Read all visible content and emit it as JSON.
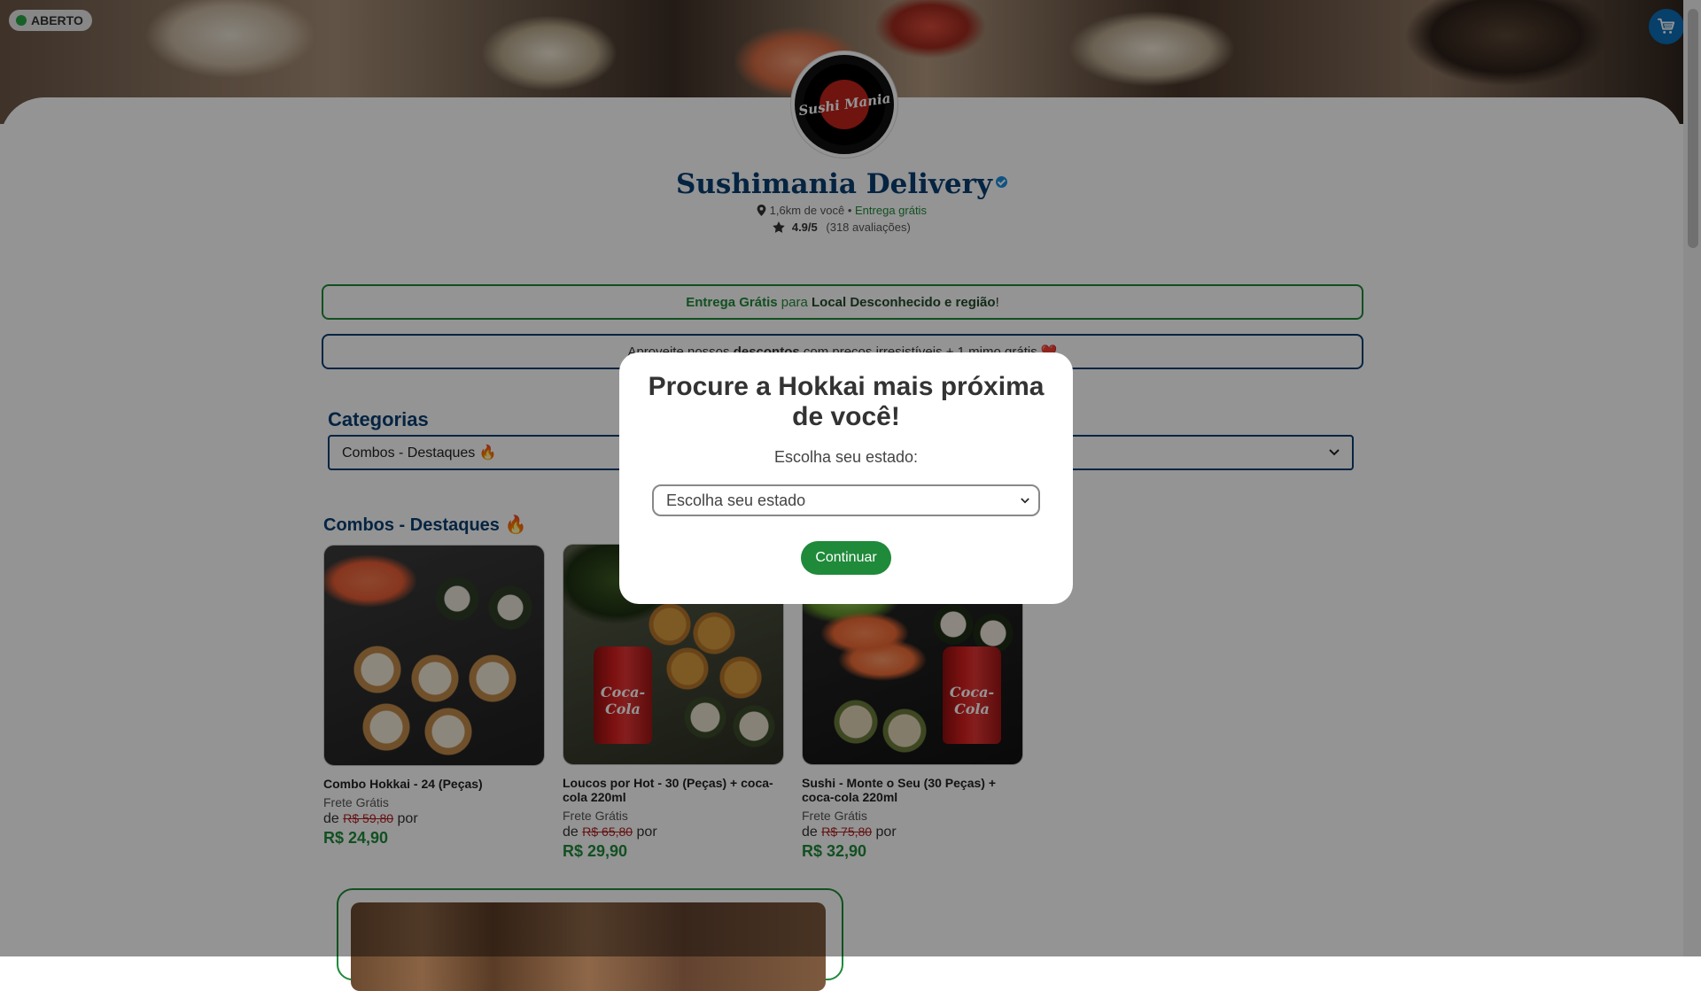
{
  "header": {
    "status": "ABERTO",
    "store_name": "Sushimania Delivery",
    "logo_text": "Sushi Mania",
    "distance": "1,6km de você",
    "separator": "•",
    "delivery": "Entrega grátis",
    "rating": "4.9/5",
    "reviews": "(318 avaliações)"
  },
  "promos": {
    "promo1_part1": "Entrega Grátis",
    "promo1_part2": "para",
    "promo1_part3": "Local Desconhecido e região",
    "promo1_part4": "!",
    "promo2_part1": "Aproveite nossos",
    "promo2_part2": "descontos",
    "promo2_part3": "com preços irresistíveis + 1 mimo grátis ❤️"
  },
  "categories": {
    "title": "Categorias",
    "selected": "Combos - Destaques 🔥"
  },
  "section": {
    "title": "Combos - Destaques 🔥"
  },
  "products": [
    {
      "name": "Combo Hokkai - 24 (Peças)",
      "shipping": "Frete Grátis",
      "de": "de",
      "old_price": "R$ 59,80",
      "por": "por",
      "price": "R$ 24,90"
    },
    {
      "name": "Loucos por Hot - 30 (Peças) + coca-cola 220ml",
      "shipping": "Frete Grátis",
      "de": "de",
      "old_price": "R$ 65,80",
      "por": "por",
      "price": "R$ 29,90"
    },
    {
      "name": "Sushi - Monte o Seu (30 Peças) + coca-cola 220ml",
      "shipping": "Frete Grátis",
      "de": "de",
      "old_price": "R$ 75,80",
      "por": "por",
      "price": "R$ 32,90"
    }
  ],
  "can_text": "Coca-Cola",
  "modal": {
    "title": "Procure a Hokkai mais próxima de você!",
    "label": "Escolha seu estado:",
    "select_placeholder": "Escolha seu estado",
    "button": "Continuar"
  },
  "colors": {
    "brand_blue": "#0a3f72",
    "green": "#1f8a3a",
    "price_red": "#b02020"
  },
  "icons": [
    "cart-icon",
    "location-pin-icon",
    "star-icon",
    "verified-icon",
    "chevron-down-icon"
  ]
}
